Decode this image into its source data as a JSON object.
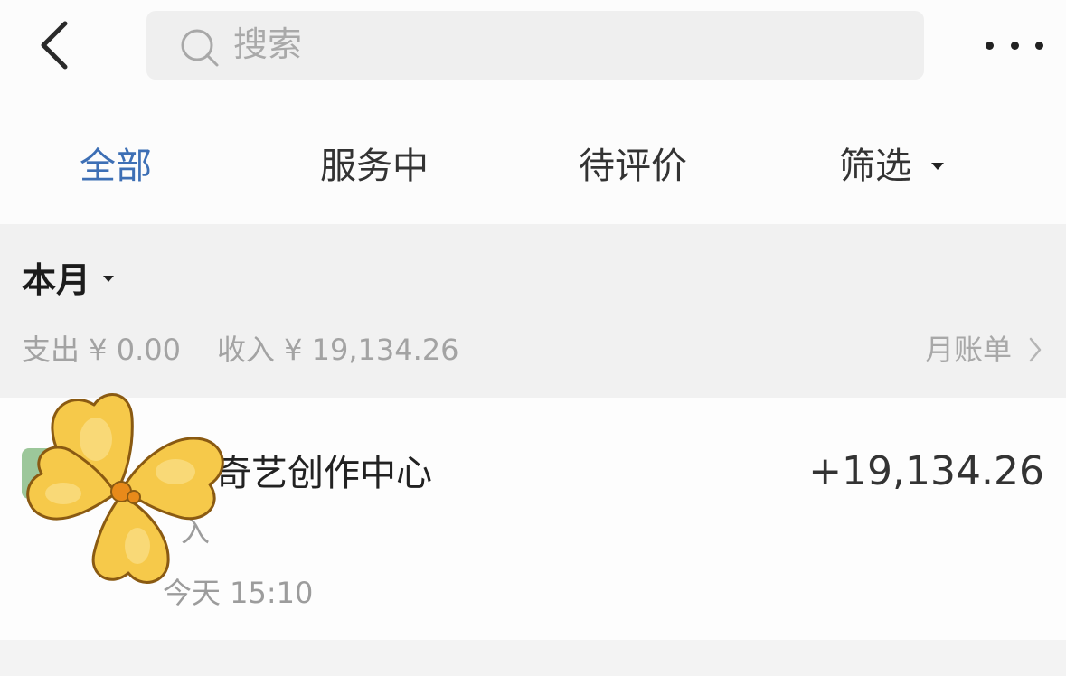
{
  "header": {
    "search_placeholder": "搜索",
    "icons": {
      "back": "chevron-left-icon",
      "search": "search-icon",
      "more": "more-dots-icon"
    }
  },
  "tabs": [
    {
      "label": "全部",
      "active": true
    },
    {
      "label": "服务中",
      "active": false
    },
    {
      "label": "待评价",
      "active": false
    },
    {
      "label": "筛选",
      "active": false
    }
  ],
  "month": {
    "label": "本月",
    "expense": "支出 ¥ 0.00",
    "income": "收入 ¥ 19,134.26",
    "monthly_bill": "月账单"
  },
  "transaction": {
    "name": "奇艺创作中心",
    "type": "入",
    "time": "今天 15:10",
    "amount": "+19,134.26"
  },
  "colors": {
    "accent": "#3d6fb5",
    "sticker_fill": "#f6c94a",
    "sticker_center": "#e88a1a"
  }
}
